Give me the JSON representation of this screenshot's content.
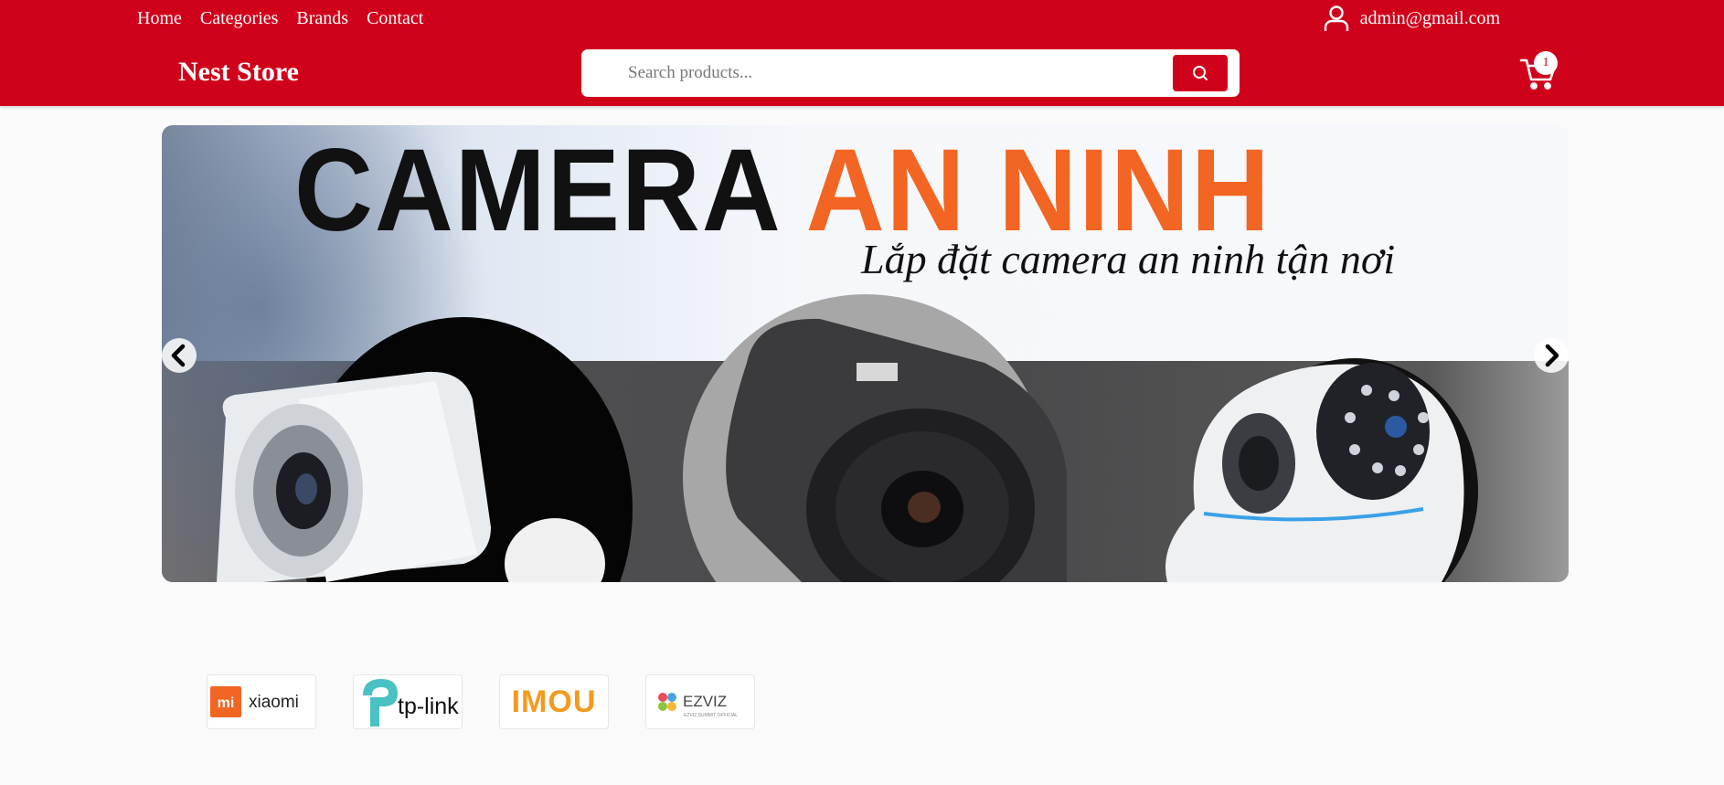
{
  "nav": {
    "items": [
      "Home",
      "Categories",
      "Brands",
      "Contact"
    ]
  },
  "account": {
    "email": "admin@gmail.com",
    "icon": "user-icon"
  },
  "brand": {
    "name": "Nest Store"
  },
  "search": {
    "placeholder": "Search products...",
    "value": "",
    "icon": "search-icon"
  },
  "cart": {
    "count": "1",
    "icon": "cart-icon"
  },
  "banner": {
    "title_dark": "CAMERA",
    "title_highlight": "AN NINH",
    "subtitle": "Lắp đặt camera an ninh tận nơi",
    "prev_icon": "chevron-left-icon",
    "next_icon": "chevron-right-icon"
  },
  "brands": [
    {
      "name": "xiaomi",
      "mark": "mi"
    },
    {
      "name": "tp-link"
    },
    {
      "name": "IMOU"
    },
    {
      "name": "EZVIZ",
      "tagline": "EZVIZ SUMMIT OFFICIAL"
    }
  ],
  "colors": {
    "primary": "#d0021b",
    "accent_orange": "#f26522",
    "background": "#fafafa"
  }
}
